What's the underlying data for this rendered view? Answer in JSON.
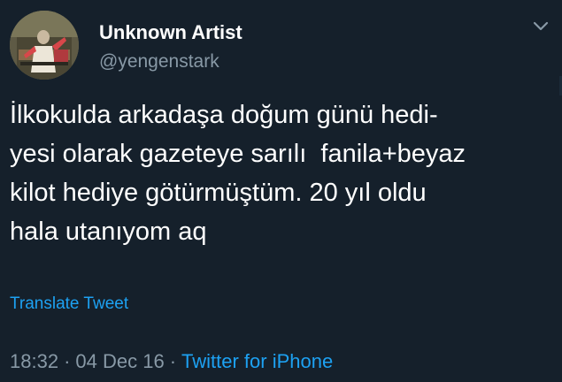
{
  "tweet": {
    "display_name": "Unknown Artist",
    "handle": "@yengenstark",
    "text_lines": [
      "İlkokulda arkadaşa doğum günü hedi-",
      "yesi olarak gazeteye sarılı  fanila+beyaz",
      "kilot hediye götürmüştüm. 20 yıl oldu",
      "hala utanıyom aq"
    ],
    "translate_label": "Translate Tweet",
    "time": "18:32",
    "date": "04 Dec 16",
    "separator": "·",
    "source": "Twitter for iPhone"
  },
  "icons": {
    "menu": "chevron-down-icon",
    "avatar": "profile-photo"
  },
  "colors": {
    "background": "#15202b",
    "primary_text": "#ffffff",
    "secondary_text": "#8899a6",
    "accent": "#1da1f2"
  }
}
